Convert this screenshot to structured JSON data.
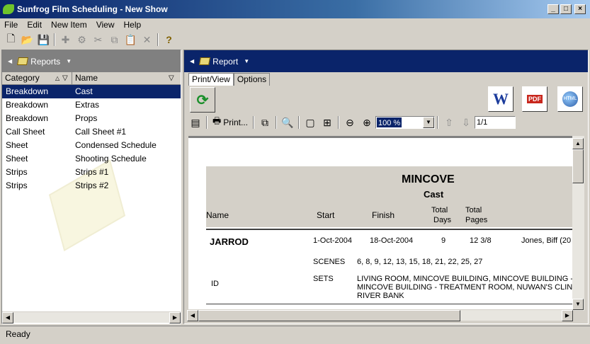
{
  "window": {
    "title": "Sunfrog Film Scheduling - New Show"
  },
  "menu": [
    "File",
    "Edit",
    "New Item",
    "View",
    "Help"
  ],
  "left_pane": {
    "header": "Reports",
    "columns": [
      "Category",
      "Name"
    ],
    "rows": [
      {
        "category": "Breakdown",
        "name": "Cast"
      },
      {
        "category": "Breakdown",
        "name": "Extras"
      },
      {
        "category": "Breakdown",
        "name": "Props"
      },
      {
        "category": "Call Sheet",
        "name": "Call Sheet #1"
      },
      {
        "category": "Sheet",
        "name": "Condensed Schedule"
      },
      {
        "category": "Sheet",
        "name": "Shooting Schedule"
      },
      {
        "category": "Strips",
        "name": "Strips #1"
      },
      {
        "category": "Strips",
        "name": "Strips #2"
      }
    ]
  },
  "right_pane": {
    "header": "Report",
    "tabs": [
      "Print/View",
      "Options"
    ],
    "export_icons": [
      "word-icon",
      "pdf-icon",
      "html-icon"
    ],
    "print_label": "Print...",
    "zoom": "100 %",
    "page": "1/1"
  },
  "report": {
    "title": "MINCOVE",
    "subtitle": "Cast",
    "col_name": "Name",
    "col_start": "Start",
    "col_finish": "Finish",
    "col_days_1": "Total",
    "col_days_2": "Days",
    "col_pages_1": "Total",
    "col_pages_2": "Pages",
    "entry_name": "JARROD",
    "entry_start": "1-Oct-2004",
    "entry_finish": "18-Oct-2004",
    "entry_days": "9",
    "entry_pages": "12 3/8",
    "entry_actor": "Jones, Biff (20",
    "id_label": "ID",
    "scenes_label": "SCENES",
    "scenes_value": "6, 8, 9, 12, 13, 15, 18, 21, 22, 25, 27",
    "sets_label": "SETS",
    "sets_line1": "LIVING ROOM, MINCOVE BUILDING, MINCOVE BUILDING -",
    "sets_line2": "MINCOVE BUILDING - TREATMENT ROOM, NUWAN'S CLIN",
    "sets_line3": "RIVER BANK"
  },
  "status": "Ready",
  "colors": {
    "title_start": "#0a246a",
    "selection": "#0a246a",
    "face": "#d4d0c8"
  }
}
